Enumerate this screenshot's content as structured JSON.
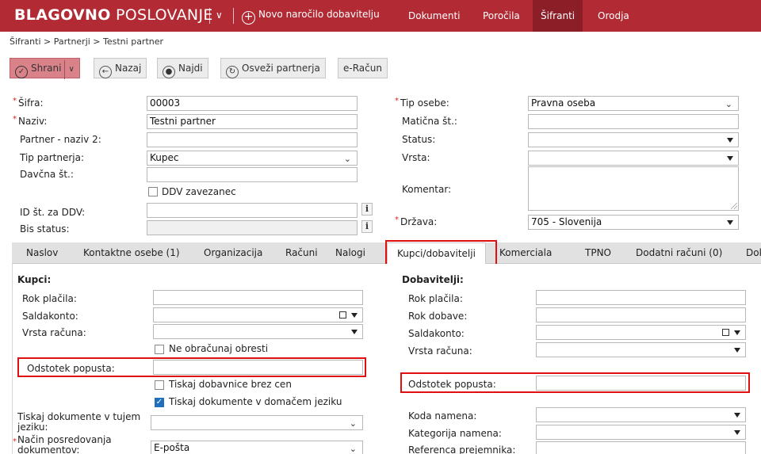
{
  "app": {
    "brand_bold": "BLAGOVNO",
    "brand_thin": " POSLOVANJE",
    "new_order": "Novo naročilo dobavitelju",
    "nav": [
      "Dokumenti",
      "Poročila",
      "Šifranti",
      "Orodja"
    ],
    "active_nav": "Šifranti",
    "accent": "#b22a34"
  },
  "breadcrumb": "Šifranti > Partnerji > Testni partner",
  "toolbar": {
    "save": "Shrani",
    "back": "Nazaj",
    "find": "Najdi",
    "refresh": "Osveži partnerja",
    "einvoice": "e-Račun"
  },
  "form": {
    "sifra_label": "Šifra:",
    "sifra_value": "00003",
    "naziv_label": "Naziv:",
    "naziv_value": "Testni partner",
    "naziv2_label": "Partner - naziv 2:",
    "naziv2_value": "",
    "tip_partnerja_label": "Tip partnerja:",
    "tip_partnerja_value": "Kupec",
    "davcna_label": "Davčna št.:",
    "davcna_value": "",
    "ddv_label": "DDV zavezanec",
    "id_ddv_label": "ID št. za DDV:",
    "bis_label": "Bis status:",
    "tip_osebe_label": "Tip osebe:",
    "tip_osebe_value": "Pravna oseba",
    "maticna_label": "Matična št.:",
    "status_label": "Status:",
    "vrsta_label": "Vrsta:",
    "komentar_label": "Komentar:",
    "drzava_label": "Država:",
    "drzava_value": "705 - Slovenija"
  },
  "tabs": [
    "Naslov",
    "Kontaktne osebe (1)",
    "Organizacija",
    "Računi",
    "Nalogi",
    "Kupci/dobavitelji",
    "Komerciala",
    "TPNO",
    "Dodatni računi (0)",
    "Dok"
  ],
  "active_tab": "Kupci/dobavitelji",
  "kupci": {
    "title": "Kupci:",
    "rok_placila": "Rok plačila:",
    "saldakonto": "Saldakonto:",
    "vrsta_racuna": "Vrsta računa:",
    "ne_obracunaj": "Ne obračunaj obresti",
    "odstotek_popusta": "Odstotek popusta:",
    "tiskaj_brez_cen": "Tiskaj dobavnice brez cen",
    "tiskaj_domacem": "Tiskaj dokumente v domačem jeziku",
    "tiskaj_tujem": "Tiskaj dokumente v tujem jeziku:",
    "nacin_posredovanja": "Način posredovanja dokumentov:",
    "nacin_value": "E-pošta"
  },
  "dobavitelji": {
    "title": "Dobavitelji:",
    "rok_placila": "Rok plačila:",
    "rok_dobave": "Rok dobave:",
    "saldakonto": "Saldakonto:",
    "vrsta_racuna": "Vrsta računa:",
    "odstotek_popusta": "Odstotek popusta:",
    "koda_namena": "Koda namena:",
    "kategorija_namena": "Kategorija namena:",
    "referenca": "Referenca prejemnika:"
  }
}
